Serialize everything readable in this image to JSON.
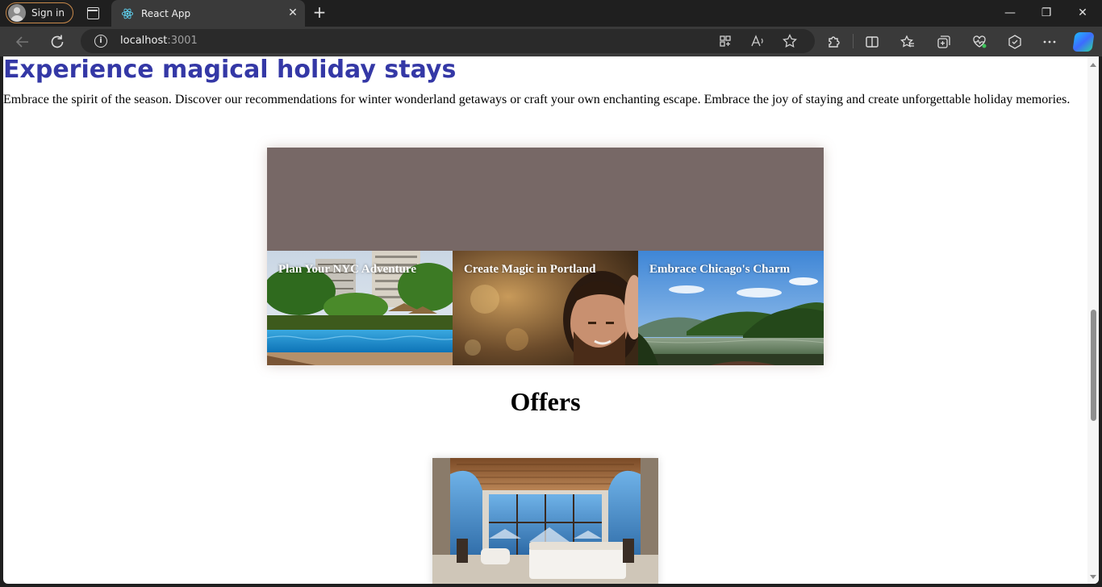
{
  "browser": {
    "sign_in_label": "Sign in",
    "tab_title": "React App",
    "tab_close": "✕",
    "new_tab": "+",
    "url_host": "localhost",
    "url_port": ":3001",
    "window_controls": {
      "minimize": "—",
      "restore": "❐",
      "close": "✕"
    },
    "icons": [
      "back-icon",
      "refresh-icon",
      "site-info-icon",
      "app-available-icon",
      "read-aloud-icon",
      "favorite-star-icon",
      "extensions-icon",
      "split-screen-icon",
      "favorites-icon",
      "collections-icon",
      "browser-essentials-icon",
      "copilot-sidebar-icon",
      "more-menu-icon",
      "copilot-icon"
    ]
  },
  "page": {
    "headline": "Experience magical holiday stays",
    "intro": "Embrace the spirit of the season. Discover our recommendations for winter wonderland getaways or craft your own enchanting escape. Embrace the joy of staying and create unforgettable holiday memories.",
    "hero_color": "#776866",
    "cards": [
      {
        "label": "Plan Your NYC Adventure",
        "image": "resort-pool"
      },
      {
        "label": "Create Magic in Portland",
        "image": "smiling-couple"
      },
      {
        "label": "Embrace Chicago's Charm",
        "image": "forest-lake"
      }
    ],
    "offers_title": "Offers",
    "offer_image": "luxury-bedroom-mountain-view"
  }
}
